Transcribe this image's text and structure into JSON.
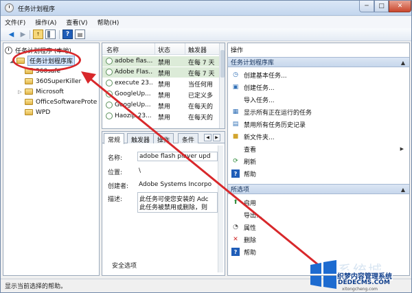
{
  "window": {
    "title": "任务计划程序",
    "minimize_glyph": "─",
    "maximize_glyph": "□",
    "close_glyph": "✕"
  },
  "menu": [
    "文件(F)",
    "操作(A)",
    "查看(V)",
    "帮助(H)"
  ],
  "toolbar": {
    "back_icon": "◀",
    "forward_icon": "▶",
    "up_icon": "↑",
    "help_icon": "?",
    "properties_icon": "▤"
  },
  "tree": {
    "root": "任务计划程序 (本地)",
    "library": "任务计划程序库",
    "children": [
      "360safe",
      "360SuperKiller",
      "Microsoft",
      "OfficeSoftwareProte",
      "WPD"
    ]
  },
  "task_list": {
    "columns": [
      "名称",
      "状态",
      "触发器"
    ],
    "rows": [
      {
        "name": "adobe flas...",
        "status": "禁用",
        "trigger": "在每 7 天"
      },
      {
        "name": "Adobe Flas...",
        "status": "禁用",
        "trigger": "在每 7 天"
      },
      {
        "name": "execute 23...",
        "status": "禁用",
        "trigger": "当任何用"
      },
      {
        "name": "GoogleUp...",
        "status": "禁用",
        "trigger": "已定义多"
      },
      {
        "name": "GoogleUp...",
        "status": "禁用",
        "trigger": "在每天的"
      },
      {
        "name": "Haozip 23...",
        "status": "禁用",
        "trigger": "在每天的"
      }
    ]
  },
  "detail": {
    "tabs": [
      "常规",
      "触发器",
      "操作",
      "条件"
    ],
    "tab_scroll_left": "◀",
    "tab_scroll_right": "▶",
    "fields": {
      "name_label": "名称:",
      "name_value": "adobe flash player upd",
      "location_label": "位置:",
      "location_value": "\\",
      "author_label": "创建者:",
      "author_value": "Adobe Systems Incorpo",
      "description_label": "描述:",
      "description_line1": "此任务可使您安装的 Adc",
      "description_line2": "此任务被禁用或删除，则",
      "security_label": "安全选项"
    }
  },
  "actions": {
    "header": "操作",
    "section1": "任务计划程序库",
    "items1": [
      {
        "icon": "clock-icon",
        "label": "创建基本任务..."
      },
      {
        "icon": "task-icon",
        "label": "创建任务..."
      },
      {
        "icon": "",
        "label": "导入任务..."
      },
      {
        "icon": "running-tasks-icon",
        "label": "显示所有正在运行的任务"
      },
      {
        "icon": "history-icon",
        "label": "禁用所有任务历史记录"
      },
      {
        "icon": "new-folder-icon",
        "label": "新文件夹..."
      },
      {
        "icon": "",
        "label": "查看"
      },
      {
        "icon": "refresh-icon",
        "label": "刷新"
      },
      {
        "icon": "help-icon",
        "label": "帮助"
      }
    ],
    "section2": "所选项",
    "items2": [
      {
        "icon": "run-icon",
        "label": "启用"
      },
      {
        "icon": "",
        "label": "导出..."
      },
      {
        "icon": "properties-icon",
        "label": "属性"
      },
      {
        "icon": "delete-icon",
        "label": "删除"
      },
      {
        "icon": "help-icon",
        "label": "帮助"
      }
    ],
    "caret": "▲",
    "submenu_arrow": "▶"
  },
  "status": "显示当前选择的帮助。",
  "watermark": {
    "big": "系统城",
    "cn": "织梦内容管理系统",
    "en": "DEDECMS.COM",
    "url": "xitongcheng.com"
  },
  "colors": {
    "annotation": "#d8282b",
    "selection_green": "#dcebd8",
    "section_blue": "#c7d7ec"
  }
}
